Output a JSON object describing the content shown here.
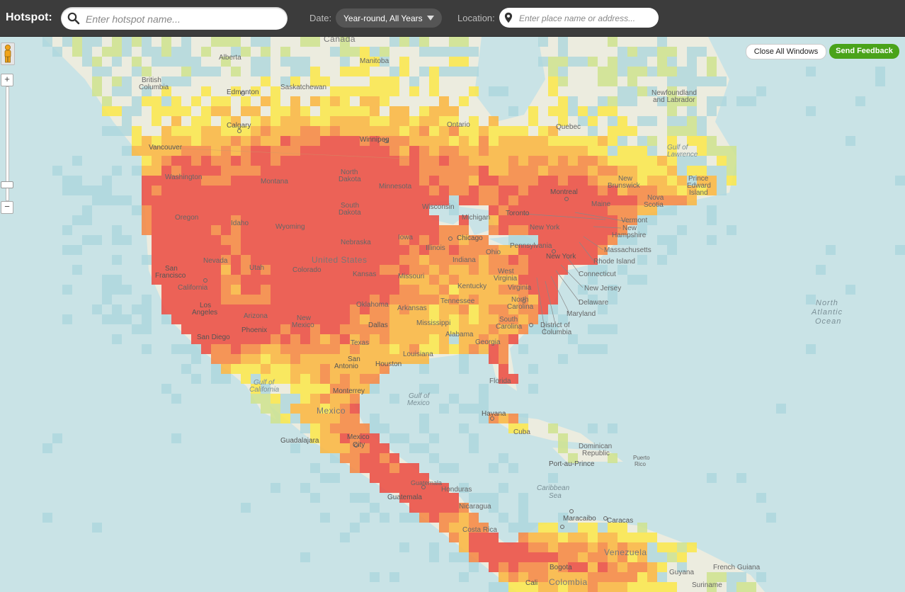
{
  "toolbar": {
    "hotspot_label": "Hotspot:",
    "hotspot_placeholder": "Enter hotspot name...",
    "date_label": "Date:",
    "date_value": "Year-round, All Years",
    "location_label": "Location:",
    "location_placeholder": "Enter place name or address..."
  },
  "map_controls": {
    "close_windows": "Close All Windows",
    "send_feedback": "Send Feedback",
    "zoom_in": "+",
    "zoom_out": "−"
  },
  "colors": {
    "water": "#c9e3e6",
    "land": "#ececdf",
    "heat_low": "#a9d6dc",
    "heat_lowmid": "#cfe38e",
    "heat_mid": "#fbe84a",
    "heat_midhigh": "#fbb63e",
    "heat_high": "#f7863f",
    "heat_max": "#ec4a40",
    "toolbar_bg": "#3c3c3c",
    "feedback_green": "#4aa31a"
  },
  "labels": {
    "canada": "Canada",
    "alberta": "Alberta",
    "manitoba": "Manitoba",
    "british": "British",
    "columbia": "Columbia",
    "edmonton": "Edmonton",
    "saskatchewan": "Saskatchewan",
    "newfoundland": "Newfoundland",
    "and_labrador": "and Labrador",
    "ontario": "Ontario",
    "quebec": "Quebec",
    "calgary": "Calgary",
    "winnipeg": "Winnipeg",
    "vancouver": "Vancouver",
    "gulf_of": "Gulf of",
    "lawrence": "Lawrence",
    "washington": "Washington",
    "north_dakota_1": "North",
    "north_dakota_2": "Dakota",
    "new_brunswick_1": "New",
    "new_brunswick_2": "Brunswick",
    "prince": "Prince",
    "edward": "Edward",
    "island": "Island",
    "montana": "Montana",
    "minnesota": "Minnesota",
    "montreal": "Montreal",
    "nova": "Nova",
    "scotia": "Scotia",
    "maine": "Maine",
    "south_dakota_1": "South",
    "south_dakota_2": "Dakota",
    "wisconsin": "Wisconsin",
    "toronto": "Toronto",
    "oregon": "Oregon",
    "vermont": "Vermont",
    "idaho": "Idaho",
    "wyoming": "Wyoming",
    "michigan": "Michigan",
    "new_york_state": "New York",
    "new_hampshire_1": "New",
    "new_hampshire_2": "Hampshire",
    "nebraska": "Nebraska",
    "iowa": "Iowa",
    "chicago": "Chicago",
    "illinois": "Illinois",
    "pennsylvania": "Pennsylvania",
    "massachusetts": "Massachusetts",
    "ohio": "Ohio",
    "nevada": "Nevada",
    "utah": "Utah",
    "united_states": "United States",
    "colorado": "Colorado",
    "indiana": "Indiana",
    "new_york_city": "New York",
    "rhode_island": "Rhode Island",
    "san": "San",
    "francisco": "Francisco",
    "kansas": "Kansas",
    "missouri": "Missouri",
    "west": "West",
    "virginia_w": "Virginia",
    "connecticut": "Connecticut",
    "california": "California",
    "kentucky": "Kentucky",
    "virginia": "Virginia",
    "new_jersey": "New Jersey",
    "los": "Los",
    "angeles": "Angeles",
    "arizona": "Arizona",
    "oklahoma": "Oklahoma",
    "arkansas": "Arkansas",
    "tennessee": "Tennessee",
    "north_carolina_1": "North",
    "north_carolina_2": "Carolina",
    "delaware": "Delaware",
    "new_mexico_1": "New",
    "new_mexico_2": "Mexico",
    "maryland": "Maryland",
    "phoenix": "Phoenix",
    "dallas": "Dallas",
    "mississippi": "Mississippi",
    "south_carolina_1": "South",
    "south_carolina_2": "Carolina",
    "district_of": "District of",
    "dc_columbia": "Columbia",
    "san_diego": "San Diego",
    "alabama": "Alabama",
    "georgia": "Georgia",
    "texas": "Texas",
    "louisiana": "Louisiana",
    "san_antonio_1": "San",
    "san_antonio_2": "Antonio",
    "houston": "Houston",
    "florida": "Florida",
    "gulf_of_california_1": "Gulf of",
    "gulf_of_california_2": "California",
    "monterrey": "Monterrey",
    "gulf_of_mexico_1": "Gulf of",
    "gulf_of_mexico_2": "Mexico",
    "mexico": "Mexico",
    "havana": "Havana",
    "cuba": "Cuba",
    "guadalajara": "Guadalajara",
    "mexico_city_1": "Mexico",
    "mexico_city_2": "City",
    "dominican": "Dominican",
    "republic": "Republic",
    "port_au_prince": "Port-au-Prince",
    "puerto": "Puerto",
    "rico": "Rico",
    "guatemala_c": "Guatemala",
    "honduras": "Honduras",
    "caribbean": "Caribbean",
    "sea": "Sea",
    "guatemala": "Guatemala",
    "nicaragua": "Nicaragua",
    "costa_rica": "Costa Rica",
    "maracaibo": "Maracaibo",
    "caracas": "Caracas",
    "venezuela": "Venezuela",
    "bogota": "Bogota",
    "cali": "Cali",
    "colombia": "Colombia",
    "guyana": "Guyana",
    "french_guiana": "French Guiana",
    "suriname": "Suriname",
    "north_atlantic_1": "North",
    "north_atlantic_2": "Atlantic",
    "north_atlantic_3": "Ocean"
  }
}
